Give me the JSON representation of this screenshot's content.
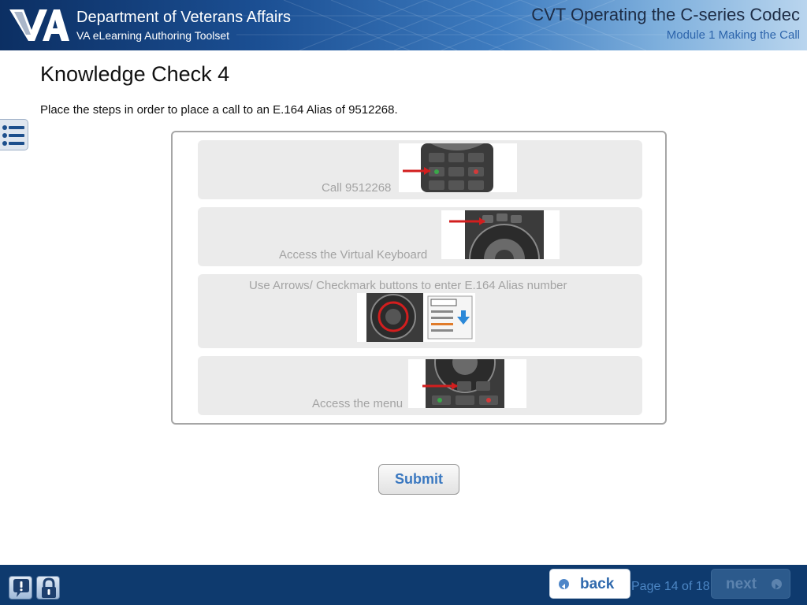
{
  "header": {
    "org_name": "Department of Veterans Affairs",
    "org_sub": "VA eLearning Authoring Toolset",
    "course_title": "CVT Operating the C-series Codec",
    "module_title": "Module 1 Making the Call",
    "logo": "va-logo"
  },
  "content": {
    "title": "Knowledge Check 4",
    "instructions": "Place the steps in order to place a call to an E.164 Alias of 9512268.",
    "items": [
      {
        "label": "Call 9512268",
        "image": "remote-call-button-thumbnail"
      },
      {
        "label": "Access the Virtual Keyboard",
        "image": "remote-keyboard-button-thumbnail"
      },
      {
        "label": "Use Arrows/ Checkmark buttons to enter E.164 Alias number",
        "image": "remote-arrows-and-dial-screen-thumbnail"
      },
      {
        "label": "Access the menu",
        "image": "remote-menu-button-thumbnail"
      }
    ],
    "submit_label": "Submit"
  },
  "footer": {
    "back_label": "back",
    "next_label": "next",
    "page_count": "Page 14 of 18",
    "help_icon": "help-icon",
    "lock_icon": "lock-icon"
  },
  "colors": {
    "header_dark": "#0c2f63",
    "header_light": "#b9d5ee",
    "footer": "#0e3a6e",
    "accent_blue": "#3a78c0",
    "item_bg": "#ebebeb",
    "item_text": "#a3a3a3"
  },
  "icons": [
    "va-logo",
    "menu-list-icon",
    "help-icon",
    "lock-icon",
    "back-arrow-icon",
    "next-arrow-icon"
  ]
}
